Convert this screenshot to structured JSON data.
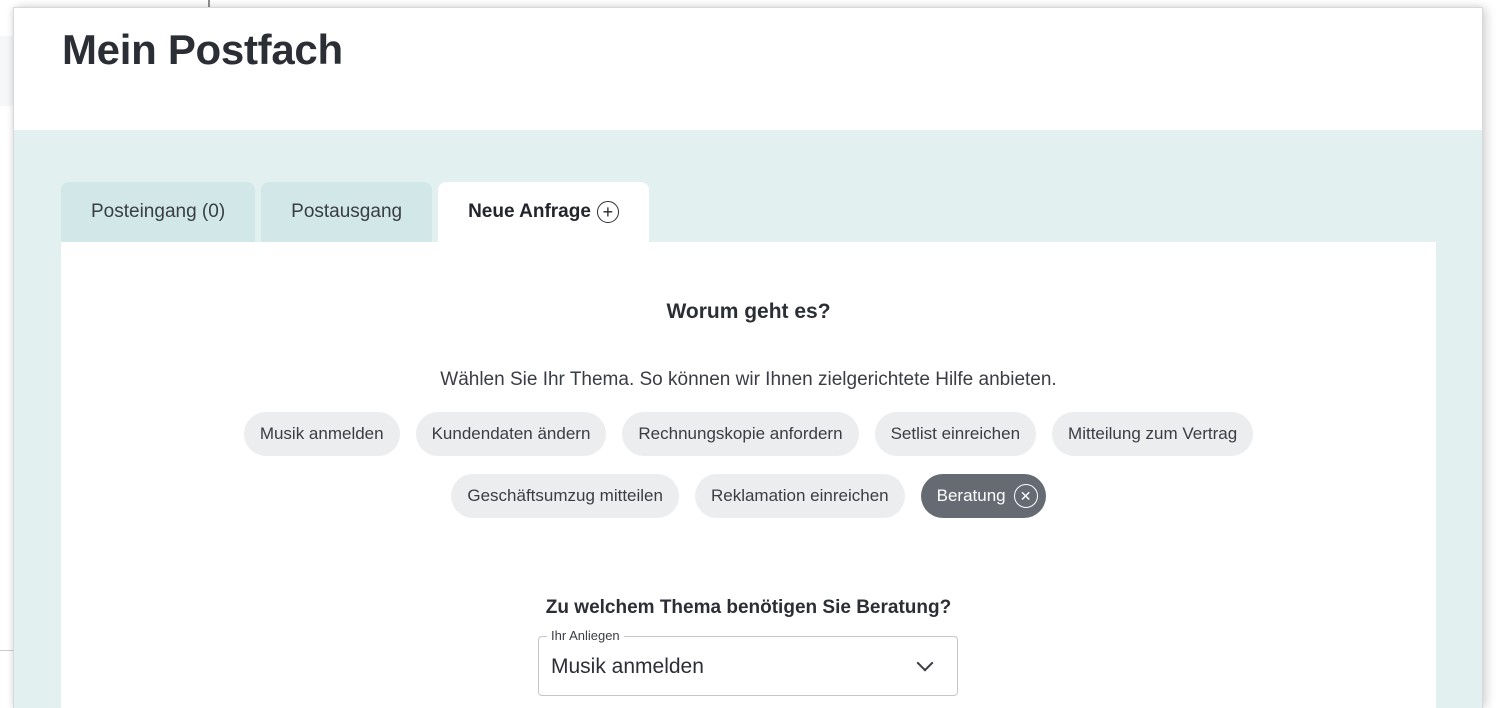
{
  "page": {
    "title": "Mein Postfach"
  },
  "tabs": [
    {
      "label": "Posteingang (0)",
      "active": false
    },
    {
      "label": "Postausgang",
      "active": false
    },
    {
      "label": "Neue Anfrage",
      "active": true,
      "icon": "plus-circle-icon"
    }
  ],
  "topic": {
    "heading": "Worum geht es?",
    "subtext": "Wählen Sie Ihr Thema. So können wir Ihnen zielgerichtete Hilfe anbieten.",
    "chips": [
      {
        "label": "Musik anmelden",
        "selected": false
      },
      {
        "label": "Kundendaten ändern",
        "selected": false
      },
      {
        "label": "Rechnungskopie anfordern",
        "selected": false
      },
      {
        "label": "Setlist einreichen",
        "selected": false
      },
      {
        "label": "Mitteilung zum Vertrag",
        "selected": false
      },
      {
        "label": "Geschäftsumzug mitteilen",
        "selected": false
      },
      {
        "label": "Reklamation einreichen",
        "selected": false
      },
      {
        "label": "Beratung",
        "selected": true,
        "icon": "close-circle-icon"
      }
    ]
  },
  "consult": {
    "question": "Zu welchem Thema benötigen Sie Beratung?",
    "select_label": "Ihr Anliegen",
    "select_value": "Musik anmelden",
    "icon": "chevron-down-icon"
  },
  "colors": {
    "body_bg": "#e3f0f0",
    "chip_bg": "#ebedef",
    "chip_selected_bg": "#656a73"
  }
}
